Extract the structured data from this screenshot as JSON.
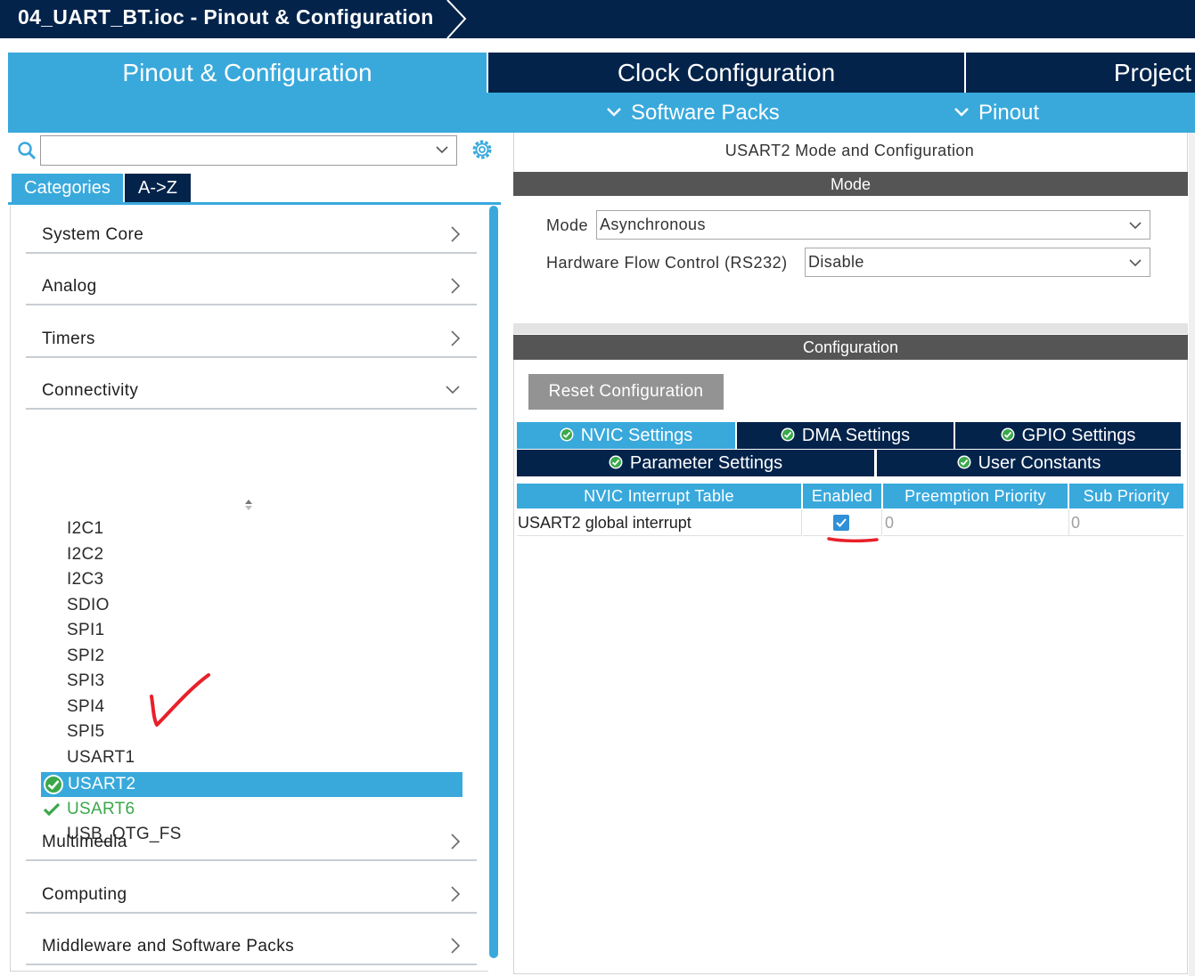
{
  "window": {
    "title": "04_UART_BT.ioc - Pinout & Configuration"
  },
  "top_tabs": [
    {
      "label": "Pinout & Configuration",
      "active": true
    },
    {
      "label": "Clock Configuration",
      "active": false
    },
    {
      "label": "Project",
      "active": false
    }
  ],
  "sub_menu": [
    {
      "label": "Software Packs"
    },
    {
      "label": "Pinout"
    }
  ],
  "left": {
    "search": {
      "value": "",
      "placeholder": ""
    },
    "view_tabs": [
      {
        "label": "Categories",
        "active": true
      },
      {
        "label": "A->Z",
        "active": false
      }
    ],
    "categories": [
      {
        "label": "System Core",
        "expanded": false
      },
      {
        "label": "Analog",
        "expanded": false
      },
      {
        "label": "Timers",
        "expanded": false
      },
      {
        "label": "Connectivity",
        "expanded": true
      },
      {
        "label": "Multimedia",
        "expanded": false
      },
      {
        "label": "Computing",
        "expanded": false
      },
      {
        "label": "Middleware and Software Packs",
        "expanded": false
      }
    ],
    "connectivity_items": [
      {
        "label": "I2C1",
        "state": "none"
      },
      {
        "label": "I2C2",
        "state": "none"
      },
      {
        "label": "I2C3",
        "state": "none"
      },
      {
        "label": "SDIO",
        "state": "none"
      },
      {
        "label": "SPI1",
        "state": "none"
      },
      {
        "label": "SPI2",
        "state": "none"
      },
      {
        "label": "SPI3",
        "state": "none"
      },
      {
        "label": "SPI4",
        "state": "none"
      },
      {
        "label": "SPI5",
        "state": "none"
      },
      {
        "label": "USART1",
        "state": "none"
      },
      {
        "label": "USART2",
        "state": "selected-configured"
      },
      {
        "label": "USART6",
        "state": "configured"
      },
      {
        "label": "USB_OTG_FS",
        "state": "none"
      }
    ]
  },
  "right": {
    "panel_title": "USART2 Mode and Configuration",
    "mode_header": "Mode",
    "mode_label": "Mode",
    "mode_value": "Asynchronous",
    "flow_label": "Hardware Flow Control (RS232)",
    "flow_value": "Disable",
    "config_header": "Configuration",
    "reset_button": "Reset Configuration",
    "settings_tabs": [
      {
        "label": "NVIC Settings",
        "active": true
      },
      {
        "label": "DMA Settings",
        "active": false
      },
      {
        "label": "GPIO Settings",
        "active": false
      },
      {
        "label": "Parameter Settings",
        "active": false
      },
      {
        "label": "User Constants",
        "active": false
      }
    ],
    "nvic_table": {
      "columns": [
        "NVIC Interrupt Table",
        "Enabled",
        "Preemption Priority",
        "Sub Priority"
      ],
      "rows": [
        {
          "name": "USART2 global interrupt",
          "enabled": true,
          "preemption": "0",
          "sub": "0"
        }
      ]
    }
  },
  "colors": {
    "navy": "#03234b",
    "accent_blue": "#39a9dc",
    "configured_green": "#3aa84a",
    "annotation_red": "#e8202a"
  }
}
